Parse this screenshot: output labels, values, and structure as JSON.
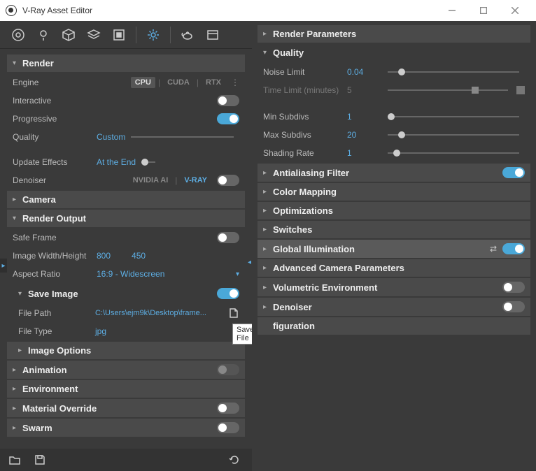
{
  "window": {
    "title": "V-Ray Asset Editor"
  },
  "tooltip": "Save File",
  "left": {
    "render": {
      "title": "Render",
      "engine": {
        "label": "Engine",
        "opts": [
          "CPU",
          "CUDA",
          "RTX"
        ],
        "active": "CPU"
      },
      "interactive": {
        "label": "Interactive",
        "on": false
      },
      "progressive": {
        "label": "Progressive",
        "on": true
      },
      "quality": {
        "label": "Quality",
        "value": "Custom"
      },
      "update_effects": {
        "label": "Update Effects",
        "value": "At the End"
      },
      "denoiser": {
        "label": "Denoiser",
        "opts": [
          "NVIDIA AI",
          "V-RAY"
        ],
        "active": "V-RAY",
        "on": false
      }
    },
    "camera": {
      "title": "Camera"
    },
    "render_output": {
      "title": "Render Output",
      "safe_frame": {
        "label": "Safe Frame",
        "on": false
      },
      "wh": {
        "label": "Image Width/Height",
        "w": "800",
        "h": "450"
      },
      "aspect": {
        "label": "Aspect Ratio",
        "value": "16:9 - Widescreen"
      },
      "save_image": {
        "title": "Save Image",
        "on": true
      },
      "file_path": {
        "label": "File Path",
        "value": "C:\\Users\\ejm9k\\Desktop\\frame..."
      },
      "file_type": {
        "label": "File Type",
        "value": "jpg"
      },
      "image_options": {
        "title": "Image Options"
      }
    },
    "animation": {
      "title": "Animation",
      "on": false
    },
    "environment": {
      "title": "Environment"
    },
    "material_override": {
      "title": "Material Override",
      "on": false
    },
    "swarm": {
      "title": "Swarm",
      "on": false
    }
  },
  "right": {
    "render_params": {
      "title": "Render Parameters"
    },
    "quality": {
      "title": "Quality",
      "noise_limit": {
        "label": "Noise Limit",
        "value": "0.04"
      },
      "time_limit": {
        "label": "Time Limit (minutes)",
        "value": "5"
      },
      "min_subdivs": {
        "label": "Min Subdivs",
        "value": "1"
      },
      "max_subdivs": {
        "label": "Max Subdivs",
        "value": "20"
      },
      "shading_rate": {
        "label": "Shading Rate",
        "value": "1"
      }
    },
    "antialiasing": {
      "title": "Antialiasing Filter",
      "on": true
    },
    "color_mapping": {
      "title": "Color Mapping"
    },
    "optimizations": {
      "title": "Optimizations"
    },
    "switches": {
      "title": "Switches"
    },
    "gi": {
      "title": "Global Illumination",
      "on": true
    },
    "adv_camera": {
      "title": "Advanced Camera Parameters"
    },
    "volumetric": {
      "title": "Volumetric Environment",
      "on": false
    },
    "denoiser": {
      "title": "Denoiser",
      "on": false
    },
    "configuration": {
      "title": "figuration"
    }
  }
}
